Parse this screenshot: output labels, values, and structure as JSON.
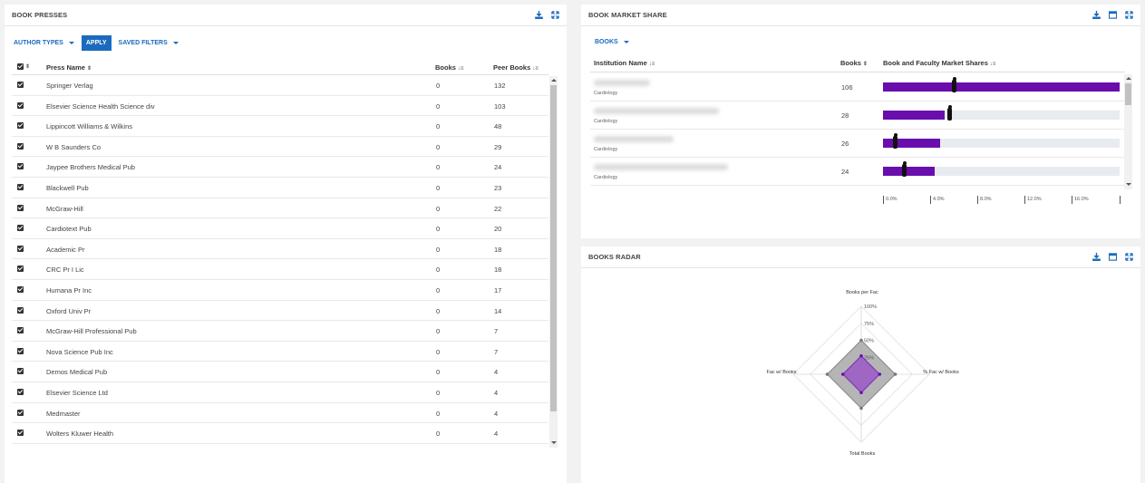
{
  "left_panel": {
    "title": "BOOK PRESSES",
    "filters": {
      "author_types": "AUTHOR TYPES",
      "apply": "APPLY",
      "saved_filters": "SAVED FILTERS"
    },
    "columns": {
      "press_name": "Press Name",
      "books": "Books",
      "peer_books": "Peer Books"
    },
    "rows": [
      {
        "name": "Springer Verlag",
        "books": "0",
        "peer": "132"
      },
      {
        "name": "Elsevier Science Health Science div",
        "books": "0",
        "peer": "103"
      },
      {
        "name": "Lippincott Williams & Wilkins",
        "books": "0",
        "peer": "48"
      },
      {
        "name": "W B Saunders Co",
        "books": "0",
        "peer": "29"
      },
      {
        "name": "Jaypee Brothers Medical Pub",
        "books": "0",
        "peer": "24"
      },
      {
        "name": "Blackwell Pub",
        "books": "0",
        "peer": "23"
      },
      {
        "name": "McGraw-Hill",
        "books": "0",
        "peer": "22"
      },
      {
        "name": "Cardiotext Pub",
        "books": "0",
        "peer": "20"
      },
      {
        "name": "Academic Pr",
        "books": "0",
        "peer": "18"
      },
      {
        "name": "CRC Pr I Lic",
        "books": "0",
        "peer": "18"
      },
      {
        "name": "Humana Pr Inc",
        "books": "0",
        "peer": "17"
      },
      {
        "name": "Oxford Univ Pr",
        "books": "0",
        "peer": "14"
      },
      {
        "name": "McGraw-Hill Professional Pub",
        "books": "0",
        "peer": "7"
      },
      {
        "name": "Nova Science Pub Inc",
        "books": "0",
        "peer": "7"
      },
      {
        "name": "Demos Medical Pub",
        "books": "0",
        "peer": "4"
      },
      {
        "name": "Elsevier Science Ltd",
        "books": "0",
        "peer": "4"
      },
      {
        "name": "Medmaster",
        "books": "0",
        "peer": "4"
      },
      {
        "name": "Wolters Kluwer Health",
        "books": "0",
        "peer": "4"
      }
    ]
  },
  "market_panel": {
    "title": "BOOK MARKET SHARE",
    "filter": "BOOKS",
    "columns": {
      "institution": "Institution Name",
      "books": "Books",
      "shares": "Book and Faculty Market Shares"
    },
    "rows": [
      {
        "dept": "Cardiology",
        "books": "106",
        "share": 1.0,
        "marker": 0.3
      },
      {
        "dept": "Cardiology",
        "books": "28",
        "share": 0.26,
        "marker": 0.28
      },
      {
        "dept": "Cardiology",
        "books": "26",
        "share": 0.24,
        "marker": 0.05
      },
      {
        "dept": "Cardiology",
        "books": "24",
        "share": 0.22,
        "marker": 0.09
      }
    ],
    "axis_ticks": [
      "0.0%",
      "4.0%",
      "8.0%",
      "12.0%",
      "16.0%"
    ]
  },
  "radar_panel": {
    "title": "BOOKS RADAR",
    "axes": {
      "top": "Books per Fac",
      "right": "% Fac w/ Books",
      "bottom": "Total Books",
      "left": "Fac w/ Books"
    },
    "scale_labels": [
      "100%",
      "75%",
      "50%",
      "25%"
    ],
    "series": {
      "outer": [
        0.5,
        0.5,
        0.5,
        0.5
      ],
      "inner": [
        0.27,
        0.27,
        0.27,
        0.27
      ]
    },
    "colors": {
      "outer": "#a8a8a8",
      "inner": "#9b59c6"
    }
  },
  "colors": {
    "accent": "#1a6bbf",
    "bar": "#6a0dad"
  }
}
